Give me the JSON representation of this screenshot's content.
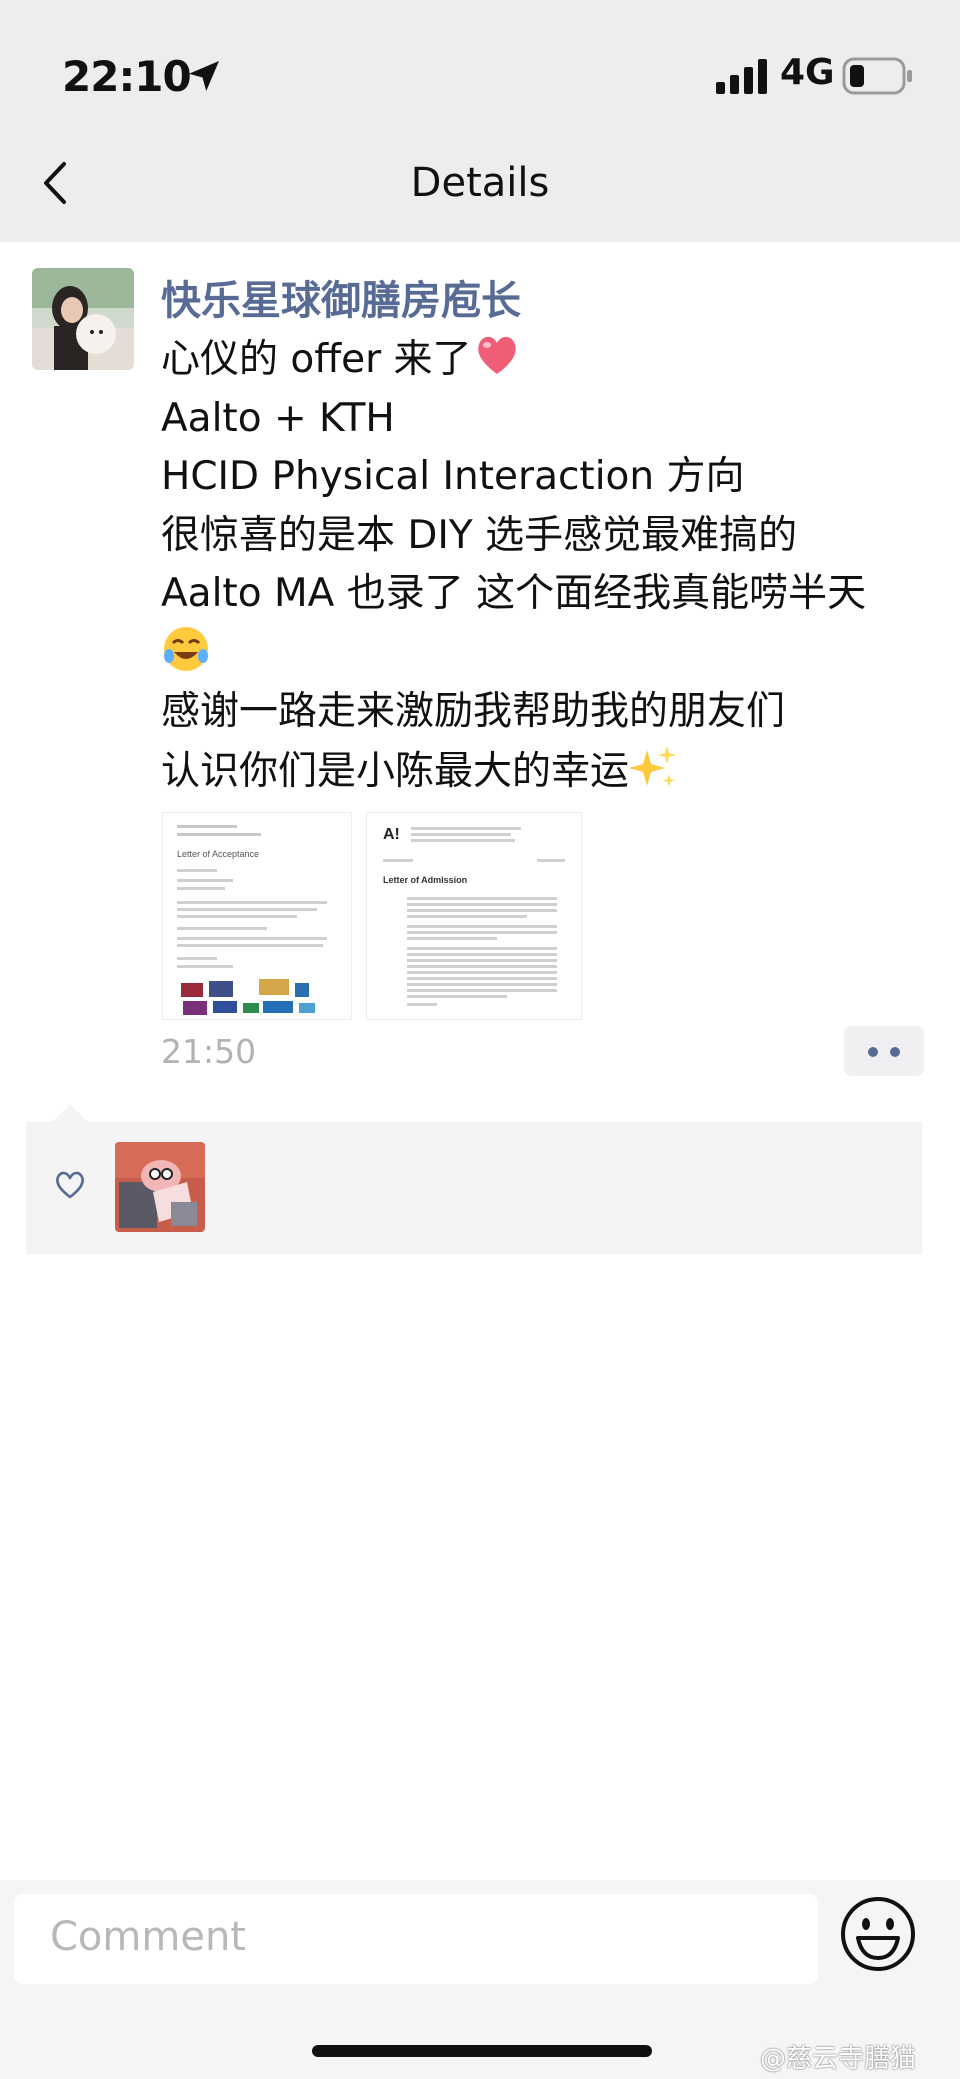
{
  "status_bar": {
    "time": "22:10",
    "network": "4G"
  },
  "nav": {
    "title": "Details"
  },
  "post": {
    "username": "快乐星球御膳房庖长",
    "lines": [
      "心仪的 offer 来了",
      "Aalto + KTH",
      "HCID Physical Interaction 方向",
      "很惊喜的是本 DIY 选手感觉最难搞的",
      "Aalto MA 也录了 这个面经我真能唠半天",
      "",
      "感谢一路走来激励我帮助我的朋友们",
      "认识你们是小陈最大的幸运"
    ],
    "images": [
      {
        "heading": "Letter of Acceptance"
      },
      {
        "brand": "A!",
        "heading": "Letter of Admission"
      }
    ],
    "time": "21:50"
  },
  "comment_bar": {
    "placeholder": "Comment"
  },
  "watermark": "@慈云寺膳猫",
  "icons": {
    "location": "location-arrow-icon",
    "signal": "signal-bars-icon",
    "battery": "battery-icon",
    "back": "chevron-left-icon",
    "like": "heart-outline-icon",
    "emoji": "smiley-icon"
  },
  "colors": {
    "username": "#576b95",
    "topbar": "#ededed",
    "likes_bg": "#f4f4f4"
  }
}
